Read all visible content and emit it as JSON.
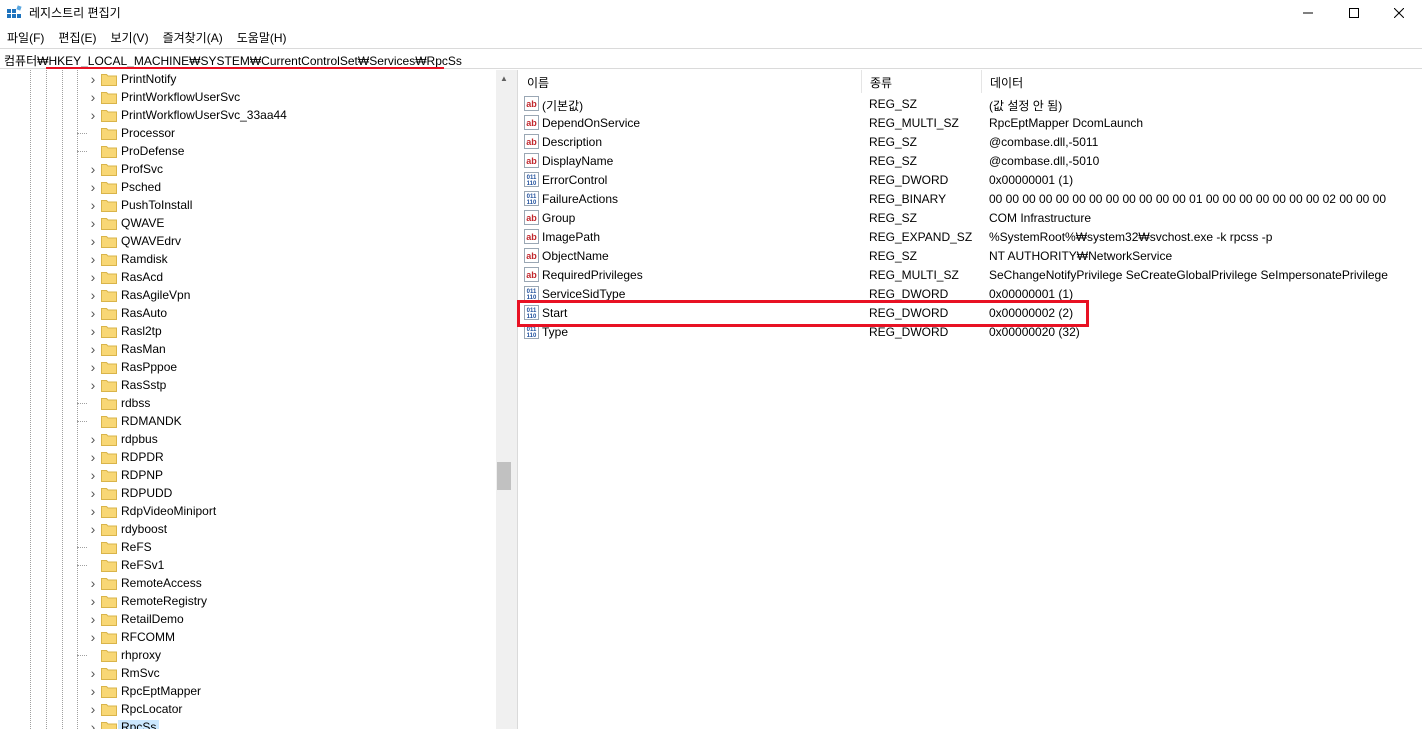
{
  "window": {
    "title": "레지스트리 편집기"
  },
  "menu": [
    "파일(F)",
    "편집(E)",
    "보기(V)",
    "즐겨찾기(A)",
    "도움말(H)"
  ],
  "address": "컴퓨터₩HKEY_LOCAL_MACHINE₩SYSTEM₩CurrentControlSet₩Services₩RpcSs",
  "tree": [
    {
      "label": "PrintNotify",
      "expandable": true
    },
    {
      "label": "PrintWorkflowUserSvc",
      "expandable": true
    },
    {
      "label": "PrintWorkflowUserSvc_33aa44",
      "expandable": true
    },
    {
      "label": "Processor",
      "expandable": false
    },
    {
      "label": "ProDefense",
      "expandable": false
    },
    {
      "label": "ProfSvc",
      "expandable": true
    },
    {
      "label": "Psched",
      "expandable": true
    },
    {
      "label": "PushToInstall",
      "expandable": true
    },
    {
      "label": "QWAVE",
      "expandable": true
    },
    {
      "label": "QWAVEdrv",
      "expandable": true
    },
    {
      "label": "Ramdisk",
      "expandable": true
    },
    {
      "label": "RasAcd",
      "expandable": true
    },
    {
      "label": "RasAgileVpn",
      "expandable": true
    },
    {
      "label": "RasAuto",
      "expandable": true
    },
    {
      "label": "Rasl2tp",
      "expandable": true
    },
    {
      "label": "RasMan",
      "expandable": true
    },
    {
      "label": "RasPppoe",
      "expandable": true
    },
    {
      "label": "RasSstp",
      "expandable": true
    },
    {
      "label": "rdbss",
      "expandable": false
    },
    {
      "label": "RDMANDK",
      "expandable": false
    },
    {
      "label": "rdpbus",
      "expandable": true
    },
    {
      "label": "RDPDR",
      "expandable": true
    },
    {
      "label": "RDPNP",
      "expandable": true
    },
    {
      "label": "RDPUDD",
      "expandable": true
    },
    {
      "label": "RdpVideoMiniport",
      "expandable": true
    },
    {
      "label": "rdyboost",
      "expandable": true
    },
    {
      "label": "ReFS",
      "expandable": false
    },
    {
      "label": "ReFSv1",
      "expandable": false
    },
    {
      "label": "RemoteAccess",
      "expandable": true
    },
    {
      "label": "RemoteRegistry",
      "expandable": true
    },
    {
      "label": "RetailDemo",
      "expandable": true
    },
    {
      "label": "RFCOMM",
      "expandable": true
    },
    {
      "label": "rhproxy",
      "expandable": false
    },
    {
      "label": "RmSvc",
      "expandable": true
    },
    {
      "label": "RpcEptMapper",
      "expandable": true
    },
    {
      "label": "RpcLocator",
      "expandable": true
    },
    {
      "label": "RpcSs",
      "expandable": true,
      "selected": true
    }
  ],
  "columns": {
    "name": "이름",
    "type": "종류",
    "data": "데이터"
  },
  "values": [
    {
      "icon": "string",
      "name": "(기본값)",
      "type": "REG_SZ",
      "data": "(값 설정 안 됨)"
    },
    {
      "icon": "string",
      "name": "DependOnService",
      "type": "REG_MULTI_SZ",
      "data": "RpcEptMapper DcomLaunch"
    },
    {
      "icon": "string",
      "name": "Description",
      "type": "REG_SZ",
      "data": "@combase.dll,-5011"
    },
    {
      "icon": "string",
      "name": "DisplayName",
      "type": "REG_SZ",
      "data": "@combase.dll,-5010"
    },
    {
      "icon": "binary",
      "name": "ErrorControl",
      "type": "REG_DWORD",
      "data": "0x00000001 (1)"
    },
    {
      "icon": "binary",
      "name": "FailureActions",
      "type": "REG_BINARY",
      "data": "00 00 00 00 00 00 00 00 00 00 00 00 01 00 00 00 00 00 00 00 02 00 00 00"
    },
    {
      "icon": "string",
      "name": "Group",
      "type": "REG_SZ",
      "data": "COM Infrastructure"
    },
    {
      "icon": "string",
      "name": "ImagePath",
      "type": "REG_EXPAND_SZ",
      "data": "%SystemRoot%₩system32₩svchost.exe -k rpcss -p"
    },
    {
      "icon": "string",
      "name": "ObjectName",
      "type": "REG_SZ",
      "data": "NT AUTHORITY₩NetworkService"
    },
    {
      "icon": "string",
      "name": "RequiredPrivileges",
      "type": "REG_MULTI_SZ",
      "data": "SeChangeNotifyPrivilege SeCreateGlobalPrivilege SeImpersonatePrivilege"
    },
    {
      "icon": "binary",
      "name": "ServiceSidType",
      "type": "REG_DWORD",
      "data": "0x00000001 (1)"
    },
    {
      "icon": "binary",
      "name": "Start",
      "type": "REG_DWORD",
      "data": "0x00000002 (2)",
      "highlighted": true
    },
    {
      "icon": "binary",
      "name": "Type",
      "type": "REG_DWORD",
      "data": "0x00000020 (32)"
    }
  ],
  "colors": {
    "highlight": "#e81123",
    "selection": "#cce8ff",
    "folder": "#f8d775"
  }
}
